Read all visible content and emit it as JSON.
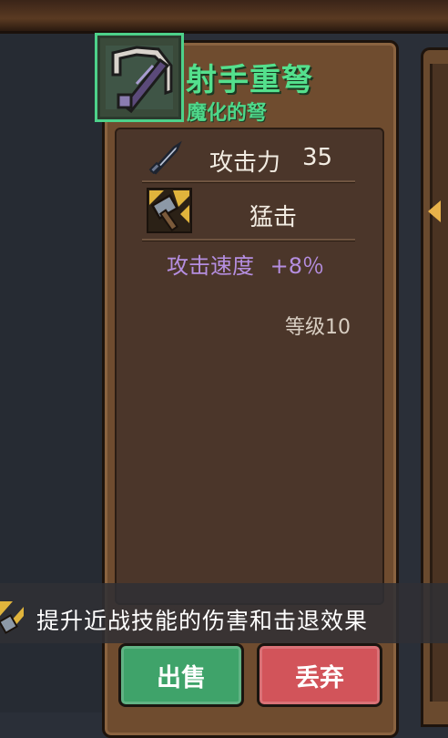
{
  "item": {
    "name": "射手重弩",
    "subtitle": "魔化的弩",
    "rarity_color": "#54e08d"
  },
  "stats": {
    "attack_label": "攻击力",
    "attack_value": "35",
    "skill_name": "猛击",
    "attack_speed_label": "攻击速度",
    "attack_speed_value": "+8％",
    "level": "等级10"
  },
  "tooltip": {
    "text": "提升近战技能的伤害和击退效果"
  },
  "buttons": {
    "sell_label": "出售",
    "drop_label": "丢弃"
  },
  "icons": [
    "crossbow-icon",
    "sword-icon",
    "hammer-skill-icon"
  ]
}
